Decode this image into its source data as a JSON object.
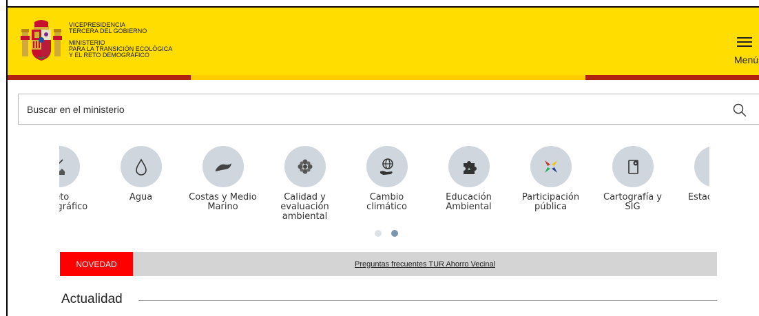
{
  "header": {
    "org_lines": [
      "VICEPRESIDENCIA",
      "TERCERA DEL GOBIERNO"
    ],
    "ministry_lines": [
      "MINISTERIO",
      "PARA LA TRANSICIÓN ECOLÓGICA",
      "Y EL RETO DEMOGRÁFICO"
    ],
    "menu_label": "Menú",
    "colors": {
      "yellow": "#ffdd00",
      "red": "#b22211"
    }
  },
  "search": {
    "placeholder": "Buscar en el ministerio",
    "value": ""
  },
  "categories": [
    {
      "label": "Reto\nDemográfico",
      "icon": "houses-chart-icon"
    },
    {
      "label": "Agua",
      "icon": "water-drop-icon"
    },
    {
      "label": "Costas y Medio\nMarino",
      "icon": "wave-icon"
    },
    {
      "label": "Calidad y\nevaluación\nambiental",
      "icon": "flower-icon"
    },
    {
      "label": "Cambio climático",
      "icon": "globe-hand-icon"
    },
    {
      "label": "Educación\nAmbiental",
      "icon": "puzzle-icon"
    },
    {
      "label": "Participación\npública",
      "icon": "arrows-icon"
    },
    {
      "label": "Cartografía y\nSIG",
      "icon": "map-pin-icon"
    },
    {
      "label": "Estadísticas",
      "icon": "stats-icon"
    }
  ],
  "carousel": {
    "pages": 2,
    "active_page": 2
  },
  "news": {
    "tag": "NOVEDAD",
    "link_text": "Preguntas frecuentes TUR Ahorro Vecinal",
    "tag_color": "#ff0000"
  },
  "section": {
    "title": "Actualidad"
  }
}
